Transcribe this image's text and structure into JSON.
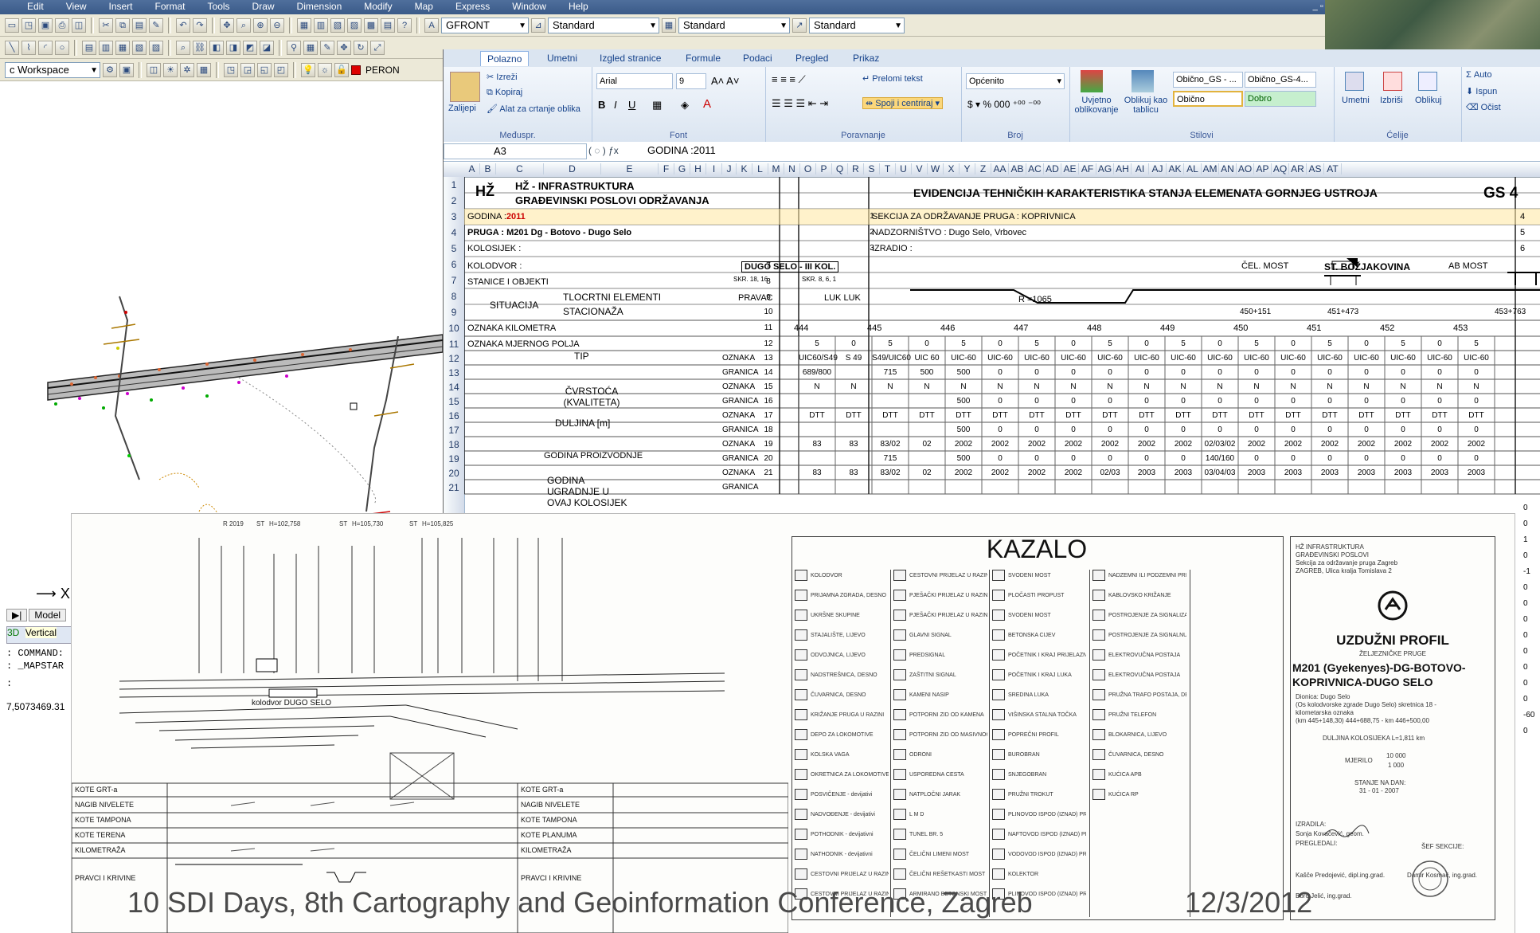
{
  "cad": {
    "menus": [
      "Edit",
      "View",
      "Insert",
      "Format",
      "Tools",
      "Draw",
      "Dimension",
      "Modify",
      "Map",
      "Express",
      "Window",
      "Help"
    ],
    "toolbar_combos": [
      "GFRONT",
      "Standard",
      "Standard",
      "Standard"
    ],
    "workspace": "c Workspace",
    "layer": "PERON",
    "tabs": [
      "Model",
      "3D",
      "Vertical"
    ],
    "command_lines": [
      ": COMMAND:",
      ": _MAPSTAR",
      ":"
    ],
    "coords": "7,5073469.31",
    "axis_x": "X"
  },
  "excel": {
    "ribbon_tabs": [
      "Polazno",
      "Umetni",
      "Izgled stranice",
      "Formule",
      "Podaci",
      "Pregled",
      "Prikaz"
    ],
    "clipboard": {
      "paste": "Zalijepi",
      "cut": "Izreži",
      "copy": "Kopiraj",
      "format_painter": "Alat za crtanje oblika",
      "group": "Međuspr."
    },
    "font": {
      "name": "Arial",
      "size": "9",
      "group": "Font"
    },
    "alignment": {
      "wrap": "Prelomi tekst",
      "merge": "Spoji i centriraj",
      "group": "Poravnanje"
    },
    "number": {
      "format": "Općenito",
      "group": "Broj"
    },
    "styles": {
      "cond": "Uvjetno oblikovanje",
      "table": "Oblikuj kao tablicu",
      "s1": "Obično_GS - ...",
      "s2": "Obično_GS-4...",
      "s3": "Obično",
      "s4": "Dobro",
      "group": "Stilovi"
    },
    "cells_grp": {
      "insert": "Umetni",
      "delete": "Izbriši",
      "format": "Oblikuj",
      "group": "Ćelije"
    },
    "editing": {
      "autosum": "Σ Auto",
      "fill": "Ispun",
      "clear": "Očist"
    },
    "name_box": "A3",
    "formula": "GODINA :2011",
    "columns": [
      "A",
      "B",
      "C",
      "D",
      "E",
      "F",
      "G",
      "H",
      "I",
      "J",
      "K",
      "L",
      "M",
      "N",
      "O",
      "P",
      "Q",
      "R",
      "S",
      "T",
      "U",
      "V",
      "W",
      "X",
      "Y",
      "Z",
      "AA",
      "AB",
      "AC",
      "AD",
      "AE",
      "AF",
      "AG",
      "AH",
      "AI",
      "AJ",
      "AK",
      "AL",
      "AM",
      "AN",
      "AO",
      "AP",
      "AQ",
      "AR",
      "AS",
      "AT"
    ],
    "rows": [
      "1",
      "2",
      "3",
      "4",
      "5",
      "6",
      "7",
      "8",
      "9",
      "10",
      "11",
      "12",
      "13",
      "14",
      "15",
      "16",
      "17",
      "18",
      "19",
      "20",
      "21"
    ],
    "sheet": {
      "hz": "HŽ",
      "org1": "HŽ - INFRASTRUKTURA",
      "org2": "GRAĐEVINSKI POSLOVI ODRŽAVANJA",
      "title": "EVIDENCIJA TEHNIČKIH KARAKTERISTIKA STANJA ELEMENATA GORNJEG USTROJA",
      "code": "GS 4",
      "godina_lbl": "GODINA :",
      "godina_val": "2011",
      "pruga": "PRUGA : M201  Dg - Botovo - Dugo Selo",
      "kolosijek": "KOLOSIJEK :",
      "kolodvor": "KOLODVOR :",
      "stanice": "STANICE I OBJEKTI",
      "situacija": "SITUACIJA",
      "tlocrtni": "TLOCRTNI ELEMENTI",
      "stacionaza": "STACIONAŽA",
      "oznaka_km": "OZNAKA KILOMETRA",
      "oznaka_mp": "OZNAKA MJERNOG POLJA",
      "sekcija": "SEKCIJA ZA ODRŽAVANJE PRUGA : KOPRIVNICA",
      "nadzor": "NADZORNIŠTVO :  Dugo Selo, Vrbovec",
      "izradio": "IZRADIO :",
      "dugo_selo": "DUGO SELO - III KOL.",
      "cel_most": "ČEL. MOST",
      "st_boz": "ST. BOŽJAKOVINA",
      "ab_most": "AB MOST",
      "pravac": "PRAVAC",
      "luk": "LUK  LUK",
      "radius": "R =1065",
      "skr1": "SKR. 18,  16",
      "skr2": "SKR. 8, 6, 1",
      "row_nums": [
        "4",
        "5",
        "6"
      ],
      "line_nums": [
        "1",
        "2",
        "3",
        "7",
        "8",
        "9",
        "10",
        "11",
        "12",
        "13",
        "14",
        "15",
        "16",
        "17",
        "18",
        "19",
        "20",
        "21"
      ],
      "km_labels": [
        "444",
        "445",
        "446",
        "447",
        "448",
        "449",
        "450",
        "451",
        "452",
        "453"
      ],
      "stac": [
        "450+151",
        "451+473",
        "453+763"
      ],
      "tip": "TIP",
      "cvrstoca": "ČVRSTOĆA (KVALITETA)",
      "duljina": "DULJINA [m]",
      "godina_proiz": "GODINA PROIZVODNJE",
      "godina_ugr": "GODINA UGRADNJE U OVAJ KOLOSIJEK",
      "oznaka": "OZNAKA",
      "granica": "GRANICA",
      "polje": [
        "5",
        "0",
        "5",
        "0",
        "5",
        "0",
        "5",
        "0",
        "5",
        "0",
        "5",
        "0",
        "5",
        "0",
        "5",
        "0",
        "5",
        "0",
        "5"
      ],
      "r12": [
        "UIC60/S49",
        "S 49",
        "S49/UIC60",
        "UIC 60",
        "UIC-60",
        "UIC-60",
        "UIC-60",
        "UIC-60",
        "UIC-60",
        "UIC-60",
        "UIC-60",
        "UIC-60",
        "UIC-60",
        "UIC-60",
        "UIC-60",
        "UIC-60",
        "UIC-60",
        "UIC-60",
        "UIC-60"
      ],
      "r13": [
        "689/800",
        "",
        "715",
        "500",
        "500",
        "0",
        "0",
        "0",
        "0",
        "0",
        "0",
        "0",
        "0",
        "0",
        "0",
        "0",
        "0",
        "0",
        "0"
      ],
      "r14": [
        "N",
        "N",
        "N",
        "N",
        "N",
        "N",
        "N",
        "N",
        "N",
        "N",
        "N",
        "N",
        "N",
        "N",
        "N",
        "N",
        "N",
        "N",
        "N"
      ],
      "r15": [
        "",
        "",
        "",
        "",
        "500",
        "0",
        "0",
        "0",
        "0",
        "0",
        "0",
        "0",
        "0",
        "0",
        "0",
        "0",
        "0",
        "0",
        "0"
      ],
      "r16": [
        "DTT",
        "DTT",
        "DTT",
        "DTT",
        "DTT",
        "DTT",
        "DTT",
        "DTT",
        "DTT",
        "DTT",
        "DTT",
        "DTT",
        "DTT",
        "DTT",
        "DTT",
        "DTT",
        "DTT",
        "DTT",
        "DTT"
      ],
      "r17": [
        "",
        "",
        "",
        "",
        "500",
        "0",
        "0",
        "0",
        "0",
        "0",
        "0",
        "0",
        "0",
        "0",
        "0",
        "0",
        "0",
        "0",
        "0"
      ],
      "r18": [
        "83",
        "83",
        "83/02",
        "02",
        "2002",
        "2002",
        "2002",
        "2002",
        "2002",
        "2002",
        "2002",
        "02/03/02",
        "2002",
        "2002",
        "2002",
        "2002",
        "2002",
        "2002",
        "2002"
      ],
      "r19": [
        "",
        "",
        "715",
        "",
        "500",
        "0",
        "0",
        "0",
        "0",
        "0",
        "0",
        "140/160",
        "0",
        "0",
        "0",
        "0",
        "0",
        "0",
        "0"
      ],
      "r20": [
        "83",
        "83",
        "83/02",
        "02",
        "2002",
        "2002",
        "2002",
        "2002",
        "02/03",
        "2003",
        "2003",
        "03/04/03",
        "2003",
        "2003",
        "2003",
        "2003",
        "2003",
        "2003",
        "2003"
      ],
      "right_edge": [
        "0",
        "0",
        "1",
        "0",
        "-1",
        "0",
        "0",
        "0",
        "0",
        "0",
        "0",
        "0",
        "0",
        "-60",
        "0"
      ]
    }
  },
  "scan": {
    "left_labels": [
      "KOTE GRT-a",
      "NAGIB NIVELETE",
      "KOTE TAMPONA",
      "KOTE TERENA",
      "KILOMETRAŽA",
      "PRAVCI I KRIVINE"
    ],
    "mid_labels": [
      "KOTE GRT-a",
      "NAGIB NIVELETE",
      "KOTE TAMPONA",
      "KOTE PLANUMA",
      "KILOMETRAŽA",
      "PRAVCI I KRIVINE"
    ],
    "kolodvor": "kolodvor DUGO SELO",
    "top_marks": [
      "R 2019",
      "ST",
      "H=102,758",
      "ST",
      "H=105,730",
      "ST",
      "H=105,825"
    ],
    "kazalo": "KAZALO",
    "stamp": {
      "org": [
        "HŽ INFRASTRUKTURA",
        "GRAĐEVINSKI POSLOVI",
        "Sekcija za održavanje pruga Zagreb",
        "ZAGREB, Ulica kralja Tomislava 2"
      ],
      "title": "UZDUŽNI PROFIL",
      "sub": "ŽELJEZNIČKE PRUGE",
      "line1": "M201 (Gyekenyes)-DG-BOTOVO-",
      "line2": "KOPRIVNICA-DUGO SELO",
      "desc": [
        "Dionica: Dugo Selo",
        "(Os kolodvorske zgrade Dugo Selo) skretnica 18 -",
        "kilometarska oznaka",
        "(km 445+148,30) 444+688,75 - km 446+500,00"
      ],
      "length": "DULJINA KOLOSIJEKA  L=1,811 km",
      "scale_lbl": "MJERILO",
      "scale_top": "10 000",
      "scale_bot": "1 000",
      "state_lbl": "STANJE NA DAN:",
      "state_date": "31 - 01 - 2007",
      "izradila": "IZRADILA:",
      "author": "Sonja Kovačević, geom.",
      "pregledali": "PREGLEDALI:",
      "chief_lbl": "ŠEF SEKCIJE:",
      "rev1": "Kašče Predojević, dipl.ing.grad.",
      "rev2": "Boro Jelić, ing.grad.",
      "chief": "Damir Kosmač, ing.grad."
    },
    "legend_items": [
      "KOLODVOR",
      "PRIJAMNA ZGRADA, DESNO",
      "UKRŠNE SKUPINE",
      "STAJALIŠTE, LIJEVO",
      "ODVOJNICA, LIJEVO",
      "NADSTREŠNICA, DESNO",
      "ČUVARNICA, DESNO",
      "KRIŽANJE PRUGA U RAZINI",
      "DEPO ZA LOKOMOTIVE",
      "KOLSKA VAGA",
      "OKRETNICA ZA LOKOMOTIVE",
      "POSVIČENJE - devijativi",
      "NADVOĐENJE - devijativi",
      "POTHODNIK - devijativni",
      "NATHODNIK - devijativni",
      "CESTOVNI PRIJELAZ U RAZINI",
      "CESTOVNI PRIJELAZ U RAZINI",
      "CESTOVNI PRIJELAZ U RAZINI",
      "PJEŠAČKI PRIJELAZ U RAZINI",
      "PJEŠAČKI PRIJELAZ U RAZINI",
      "GLAVNI SIGNAL",
      "PREDSIGNAL",
      "ZAŠTITNI SIGNAL",
      "KAMENI NASIP",
      "POTPORNI ZID OD KAMENA",
      "POTPORNI ZID OD MASIVNOG",
      "ODRONI",
      "USPOREDNA CESTA",
      "NATPLOČNI JARAK",
      "L M D",
      "TUNEL BR. 5",
      "ČELIČNI LIMENI MOST",
      "ČELIČNI REŠETKASTI MOST",
      "ARMIRANO BETONSKI MOST",
      "SVODENI MOST",
      "PLOČASTI PROPUST",
      "SVODENI MOST",
      "BETONSKA CIJEV",
      "POČETNIK I KRAJ PRIJELAZNOG LUKA",
      "POČETNIK I KRAJ LUKA",
      "SREDINA LUKA",
      "VIŠINSKA STALNA TOČKA",
      "POPREČNI PROFIL",
      "BUROBRAN",
      "SNJEGOBRAN",
      "PRUŽNI TROKUT",
      "PLINOVOD ISPOD (IZNAD) PRUGE",
      "NAFTOVOD ISPOD (IZNAD) PRUGE",
      "VODOVOD ISPOD (IZNAD) PRUGE",
      "KOLEKTOR",
      "PLINOVOD ISPOD (IZNAD) PRUGE",
      "NADZEMNI ILI PODZEMNI PRIJELAZ JAKE STRUJE",
      "KABLOVSKO KRIŽANJE",
      "POSTROJENJE ZA SIGNALIZACIJU",
      "POSTROJENJE ZA SIGNALNU",
      "ELEKTROVUČNA POSTAJA",
      "ELEKTROVUČNA POSTAJA",
      "PRUŽNA TRAFO POSTAJA, DESNO",
      "PRUŽNI TELEFON",
      "BLOKARNICA, LIJEVO",
      "ČUVARNICA, DESNO",
      "KUĆICA APB",
      "KUĆICA RP"
    ]
  },
  "footer": {
    "left": "10 SDI Days, 8th Cartography and Geoinformation Conference, Zagreb",
    "right": "12/3/2012"
  }
}
